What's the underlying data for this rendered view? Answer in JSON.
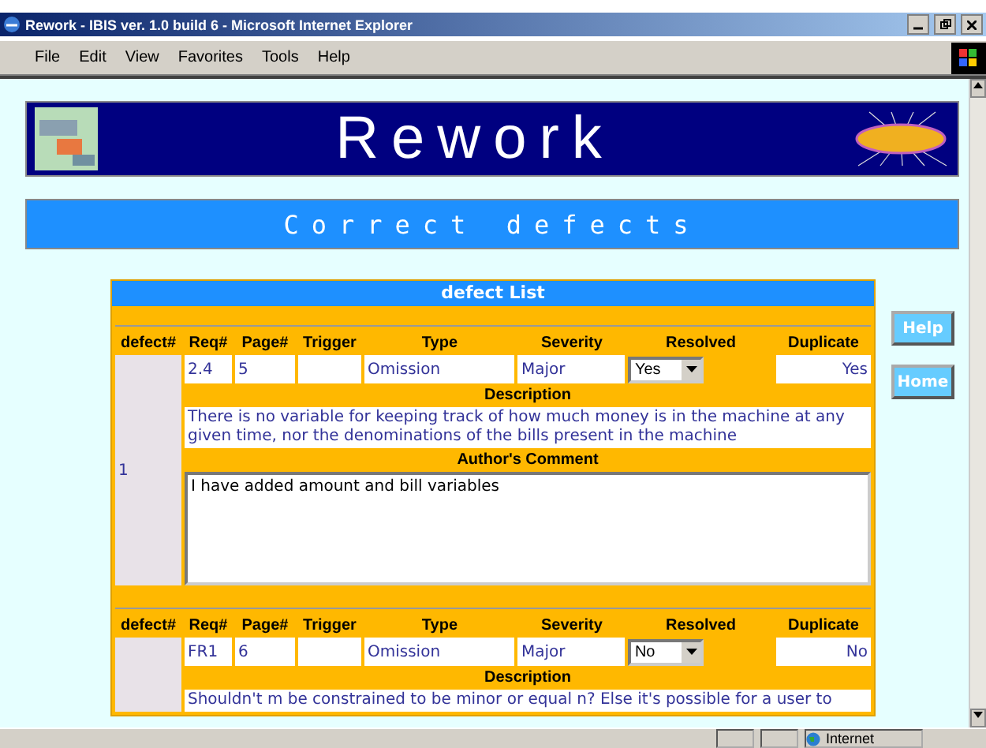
{
  "window": {
    "title": "Rework - IBIS ver. 1.0 build 6 - Microsoft Internet Explorer"
  },
  "menu": [
    "File",
    "Edit",
    "View",
    "Favorites",
    "Tools",
    "Help"
  ],
  "banner": {
    "title": "Rework"
  },
  "section": {
    "title": "Correct defects"
  },
  "defect_list": {
    "title": "defect List",
    "defects": [
      {
        "columns": [
          "defect#",
          "Req#",
          "Page#",
          "Trigger",
          "Type",
          "Severity",
          "Resolved",
          "Duplicate"
        ],
        "number": "1",
        "req": "2.4",
        "page": "5",
        "type": "Omission",
        "severity": "Major",
        "resolved": "Yes",
        "duplicate": "Yes",
        "description_label": "Description",
        "description": "There is no variable for keeping track of how much money is in the machine at any given time, nor the denominations of the bills present in the machine",
        "comment_label": "Author's Comment",
        "comment": "I have added amount and bill variables"
      },
      {
        "columns": [
          "defect#",
          "Req#",
          "Page#",
          "Trigger",
          "Type",
          "Severity",
          "Resolved",
          "Duplicate"
        ],
        "req": "FR1",
        "page": "6",
        "type": "Omission",
        "severity": "Major",
        "resolved": "No",
        "duplicate": "No",
        "description_label": "Description",
        "description": "Shouldn't m be constrained to be minor or equal n? Else it's possible for a user to"
      }
    ]
  },
  "side_buttons": [
    "Help",
    "Home"
  ],
  "status_bar": {
    "zone": "Internet"
  }
}
